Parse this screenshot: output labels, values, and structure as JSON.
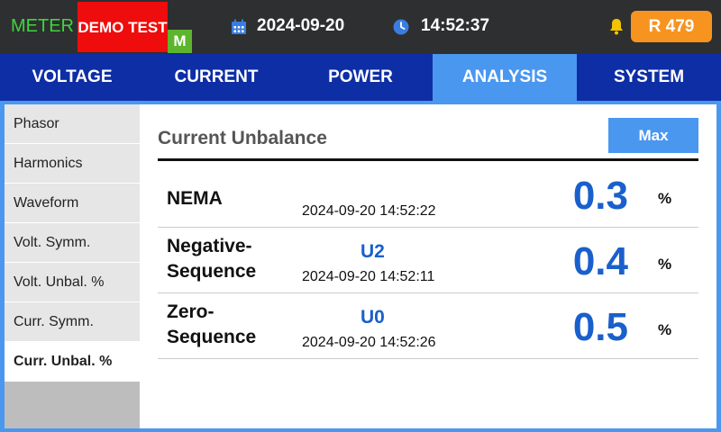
{
  "status": {
    "mode": "METER",
    "demo_label": "DEMO TEST",
    "m_badge": "M",
    "date": "2024-09-20",
    "time": "14:52:37",
    "record_badge": "R 479",
    "icons": [
      "calendar-icon",
      "clock-icon",
      "bell-icon"
    ]
  },
  "tabs": [
    {
      "label": "VOLTAGE"
    },
    {
      "label": "CURRENT"
    },
    {
      "label": "POWER"
    },
    {
      "label": "ANALYSIS",
      "active": true
    },
    {
      "label": "SYSTEM"
    }
  ],
  "sidebar": {
    "items": [
      {
        "label": "Phasor"
      },
      {
        "label": "Harmonics"
      },
      {
        "label": "Waveform"
      },
      {
        "label": "Volt. Symm."
      },
      {
        "label": "Volt. Unbal. %"
      },
      {
        "label": "Curr. Symm."
      },
      {
        "label": "Curr. Unbal. %",
        "active": true
      }
    ]
  },
  "panel": {
    "title": "Current Unbalance",
    "max_button": "Max",
    "rows": [
      {
        "name_line1": "NEMA",
        "name_line2": "",
        "symbol": "",
        "timestamp": "2024-09-20 14:52:22",
        "value": "0.3",
        "unit": "%"
      },
      {
        "name_line1": "Negative-",
        "name_line2": "Sequence",
        "symbol": "U2",
        "timestamp": "2024-09-20 14:52:11",
        "value": "0.4",
        "unit": "%"
      },
      {
        "name_line1": "Zero-",
        "name_line2": "Sequence",
        "symbol": "U0",
        "timestamp": "2024-09-20 14:52:26",
        "value": "0.5",
        "unit": "%"
      }
    ]
  },
  "colors": {
    "topbar": "#2e2f30",
    "tab_bar": "#0e2ea6",
    "accent": "#4a97f0",
    "value_blue": "#1a60cc",
    "demo_red": "#ee0c0c",
    "badge_orange": "#f79420",
    "meter_green": "#3dd63d"
  }
}
